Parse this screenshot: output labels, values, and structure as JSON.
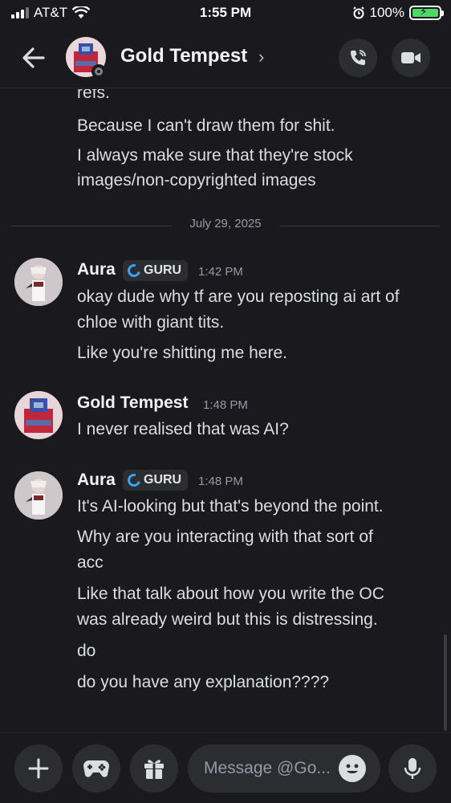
{
  "status_bar": {
    "carrier": "AT&T",
    "time": "1:55 PM",
    "battery": "100%"
  },
  "header": {
    "title": "Gold Tempest",
    "chevron": "›"
  },
  "chat": {
    "continued_lines": [
      "refs.",
      "Because I can't draw them for shit.",
      "I always make sure that they're stock",
      "images/non-copyrighted images"
    ],
    "date_divider": "July 29, 2025",
    "messages": [
      {
        "author": "Aura",
        "badge": "GURU",
        "time": "1:42 PM",
        "lines": [
          "okay dude why tf are you reposting ai art of",
          "chloe with giant tits.",
          "Like you're shitting me here."
        ]
      },
      {
        "author": "Gold Tempest",
        "time": "1:48 PM",
        "lines": [
          "I never realised that was AI?"
        ]
      },
      {
        "author": "Aura",
        "badge": "GURU",
        "time": "1:48 PM",
        "lines": [
          "It's AI-looking but that's beyond the point.",
          "Why are you interacting with that sort of",
          "acc",
          "Like that talk about how you write the OC",
          "was already weird but this is distressing.",
          "do",
          "do you have any explanation????"
        ]
      }
    ]
  },
  "composer": {
    "placeholder": "Message @Go..."
  },
  "colors": {
    "background": "#1a1a1e",
    "surface": "#2b2d31",
    "badge_icon": "#3ba4f2",
    "battery": "#4cd964"
  }
}
